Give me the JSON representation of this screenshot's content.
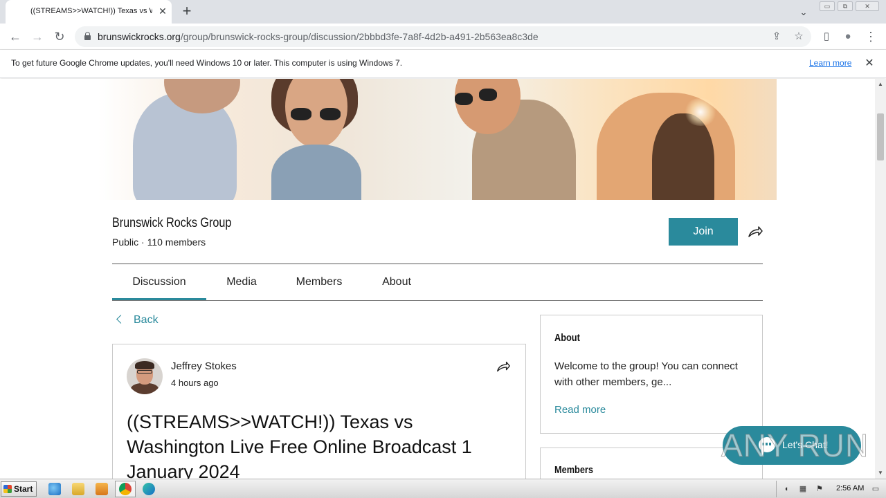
{
  "browser": {
    "tab_title": "((STREAMS>>WATCH!)) Texas vs W",
    "tab_close": "✕",
    "new_tab": "+",
    "tab_search": "⌄",
    "url_host": "brunswickrocks.org",
    "url_path": "/group/brunswick-rocks-group/discussion/2bbbd3fe-7a8f-4d2b-a491-2b563ea8c3de",
    "back": "←",
    "forward": "→",
    "reload": "↻",
    "share": "⇪",
    "bookmark": "☆",
    "sidepanel": "▯",
    "profile": "●",
    "menu": "⋮",
    "win_minimize": "▭",
    "win_restore": "⧉",
    "win_close": "✕"
  },
  "infobar": {
    "message": "To get future Google Chrome updates, you'll need Windows 10 or later. This computer is using Windows 7.",
    "link": "Learn more",
    "close": "✕"
  },
  "group": {
    "name": "Brunswick Rocks Group",
    "meta": "Public · 110 members",
    "join_label": "Join"
  },
  "tabs": [
    {
      "label": "Discussion",
      "active": true
    },
    {
      "label": "Media",
      "active": false
    },
    {
      "label": "Members",
      "active": false
    },
    {
      "label": "About",
      "active": false
    }
  ],
  "back_label": "Back",
  "post": {
    "author": "Jeffrey Stokes",
    "time": "4 hours ago",
    "title": "((STREAMS>>WATCH!)) Texas vs Washington Live Free Online Broadcast 1 January 2024"
  },
  "sidebar": {
    "about_heading": "About",
    "about_text": "Welcome to the group! You can connect with other members, ge...",
    "read_more": "Read more",
    "members_heading": "Members"
  },
  "chat": {
    "label": "Let's Chat!"
  },
  "watermark": "ANY RUN",
  "taskbar": {
    "start": "Start",
    "clock": "2:56 AM"
  },
  "colors": {
    "accent": "#2a8a9c"
  }
}
